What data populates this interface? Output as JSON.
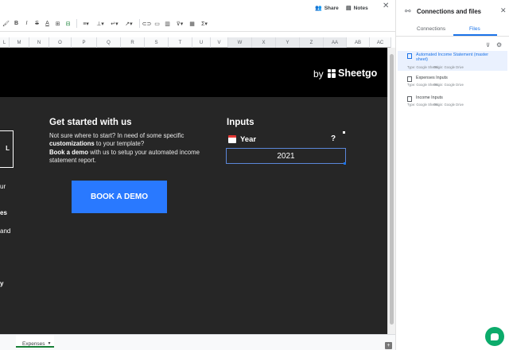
{
  "header": {
    "share_label": "Share",
    "notes_label": "Notes",
    "close_glyph": "✕"
  },
  "toolbar": {
    "icons": [
      "paint-format-icon",
      "bold-icon",
      "italic-icon",
      "underline-icon",
      "strikethrough-icon",
      "text-color-icon",
      "borders-icon",
      "merge-cells-icon",
      "align-icon",
      "valign-icon",
      "wrap-icon",
      "rotate-icon",
      "link-icon",
      "comment-icon",
      "chart-icon",
      "filter-icon",
      "filter-views-icon",
      "functions-icon"
    ]
  },
  "columns": [
    "L",
    "M",
    "N",
    "O",
    "P",
    "Q",
    "R",
    "S",
    "T",
    "U",
    "V",
    "W",
    "X",
    "Y",
    "Z",
    "AA",
    "AB",
    "AC"
  ],
  "banner": {
    "by": "by",
    "brand": "Sheetgo"
  },
  "left_fragments": {
    "box": "L",
    "f1": "ur",
    "f2": "es",
    "f3": "and",
    "f4": "y"
  },
  "get_started": {
    "title": "Get started with us",
    "line1": "Not sure where to start? In need of some specific ",
    "bold1": "customizations",
    "line2": " to your template?",
    "bold2": "Book a demo",
    "line3": " with us to setup your automated income statement report.",
    "button": "BOOK A DEMO"
  },
  "inputs": {
    "title": "Inputs",
    "year_label": "Year",
    "help": "?",
    "year_value": "2021"
  },
  "tabs": {
    "expenses": "Expenses",
    "add": "+"
  },
  "panel": {
    "title": "Connections and files",
    "tab_connections": "Connections",
    "tab_files": "Files",
    "files": [
      {
        "name": "Automated Income Statement (master sheet)",
        "type": "Type: Google Sheets",
        "origin": "Origin: Google Drive"
      },
      {
        "name": "Expenses Inputs",
        "type": "Type: Google Sheets",
        "origin": "Origin: Google Drive"
      },
      {
        "name": "Income Inputs",
        "type": "Type: Google Sheets",
        "origin": "Origin: Google Drive"
      }
    ]
  },
  "colors": {
    "sheet_bg": "#262626",
    "banner_bg": "#000000",
    "accent": "#2979ff",
    "panel_accent": "#1a73e8",
    "chat": "#0cab6b"
  }
}
